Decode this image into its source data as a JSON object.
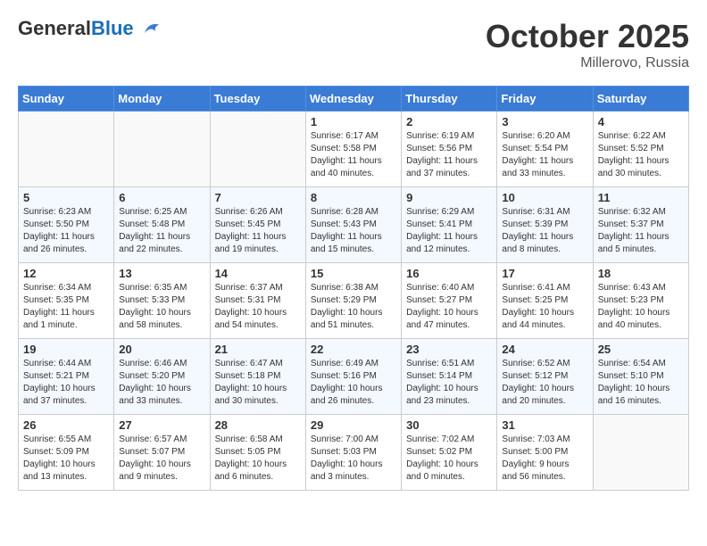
{
  "header": {
    "logo_general": "General",
    "logo_blue": "Blue",
    "month_title": "October 2025",
    "location": "Millerovo, Russia"
  },
  "weekdays": [
    "Sunday",
    "Monday",
    "Tuesday",
    "Wednesday",
    "Thursday",
    "Friday",
    "Saturday"
  ],
  "weeks": [
    [
      {
        "day": "",
        "info": ""
      },
      {
        "day": "",
        "info": ""
      },
      {
        "day": "",
        "info": ""
      },
      {
        "day": "1",
        "info": "Sunrise: 6:17 AM\nSunset: 5:58 PM\nDaylight: 11 hours\nand 40 minutes."
      },
      {
        "day": "2",
        "info": "Sunrise: 6:19 AM\nSunset: 5:56 PM\nDaylight: 11 hours\nand 37 minutes."
      },
      {
        "day": "3",
        "info": "Sunrise: 6:20 AM\nSunset: 5:54 PM\nDaylight: 11 hours\nand 33 minutes."
      },
      {
        "day": "4",
        "info": "Sunrise: 6:22 AM\nSunset: 5:52 PM\nDaylight: 11 hours\nand 30 minutes."
      }
    ],
    [
      {
        "day": "5",
        "info": "Sunrise: 6:23 AM\nSunset: 5:50 PM\nDaylight: 11 hours\nand 26 minutes."
      },
      {
        "day": "6",
        "info": "Sunrise: 6:25 AM\nSunset: 5:48 PM\nDaylight: 11 hours\nand 22 minutes."
      },
      {
        "day": "7",
        "info": "Sunrise: 6:26 AM\nSunset: 5:45 PM\nDaylight: 11 hours\nand 19 minutes."
      },
      {
        "day": "8",
        "info": "Sunrise: 6:28 AM\nSunset: 5:43 PM\nDaylight: 11 hours\nand 15 minutes."
      },
      {
        "day": "9",
        "info": "Sunrise: 6:29 AM\nSunset: 5:41 PM\nDaylight: 11 hours\nand 12 minutes."
      },
      {
        "day": "10",
        "info": "Sunrise: 6:31 AM\nSunset: 5:39 PM\nDaylight: 11 hours\nand 8 minutes."
      },
      {
        "day": "11",
        "info": "Sunrise: 6:32 AM\nSunset: 5:37 PM\nDaylight: 11 hours\nand 5 minutes."
      }
    ],
    [
      {
        "day": "12",
        "info": "Sunrise: 6:34 AM\nSunset: 5:35 PM\nDaylight: 11 hours\nand 1 minute."
      },
      {
        "day": "13",
        "info": "Sunrise: 6:35 AM\nSunset: 5:33 PM\nDaylight: 10 hours\nand 58 minutes."
      },
      {
        "day": "14",
        "info": "Sunrise: 6:37 AM\nSunset: 5:31 PM\nDaylight: 10 hours\nand 54 minutes."
      },
      {
        "day": "15",
        "info": "Sunrise: 6:38 AM\nSunset: 5:29 PM\nDaylight: 10 hours\nand 51 minutes."
      },
      {
        "day": "16",
        "info": "Sunrise: 6:40 AM\nSunset: 5:27 PM\nDaylight: 10 hours\nand 47 minutes."
      },
      {
        "day": "17",
        "info": "Sunrise: 6:41 AM\nSunset: 5:25 PM\nDaylight: 10 hours\nand 44 minutes."
      },
      {
        "day": "18",
        "info": "Sunrise: 6:43 AM\nSunset: 5:23 PM\nDaylight: 10 hours\nand 40 minutes."
      }
    ],
    [
      {
        "day": "19",
        "info": "Sunrise: 6:44 AM\nSunset: 5:21 PM\nDaylight: 10 hours\nand 37 minutes."
      },
      {
        "day": "20",
        "info": "Sunrise: 6:46 AM\nSunset: 5:20 PM\nDaylight: 10 hours\nand 33 minutes."
      },
      {
        "day": "21",
        "info": "Sunrise: 6:47 AM\nSunset: 5:18 PM\nDaylight: 10 hours\nand 30 minutes."
      },
      {
        "day": "22",
        "info": "Sunrise: 6:49 AM\nSunset: 5:16 PM\nDaylight: 10 hours\nand 26 minutes."
      },
      {
        "day": "23",
        "info": "Sunrise: 6:51 AM\nSunset: 5:14 PM\nDaylight: 10 hours\nand 23 minutes."
      },
      {
        "day": "24",
        "info": "Sunrise: 6:52 AM\nSunset: 5:12 PM\nDaylight: 10 hours\nand 20 minutes."
      },
      {
        "day": "25",
        "info": "Sunrise: 6:54 AM\nSunset: 5:10 PM\nDaylight: 10 hours\nand 16 minutes."
      }
    ],
    [
      {
        "day": "26",
        "info": "Sunrise: 6:55 AM\nSunset: 5:09 PM\nDaylight: 10 hours\nand 13 minutes."
      },
      {
        "day": "27",
        "info": "Sunrise: 6:57 AM\nSunset: 5:07 PM\nDaylight: 10 hours\nand 9 minutes."
      },
      {
        "day": "28",
        "info": "Sunrise: 6:58 AM\nSunset: 5:05 PM\nDaylight: 10 hours\nand 6 minutes."
      },
      {
        "day": "29",
        "info": "Sunrise: 7:00 AM\nSunset: 5:03 PM\nDaylight: 10 hours\nand 3 minutes."
      },
      {
        "day": "30",
        "info": "Sunrise: 7:02 AM\nSunset: 5:02 PM\nDaylight: 10 hours\nand 0 minutes."
      },
      {
        "day": "31",
        "info": "Sunrise: 7:03 AM\nSunset: 5:00 PM\nDaylight: 9 hours\nand 56 minutes."
      },
      {
        "day": "",
        "info": ""
      }
    ]
  ]
}
